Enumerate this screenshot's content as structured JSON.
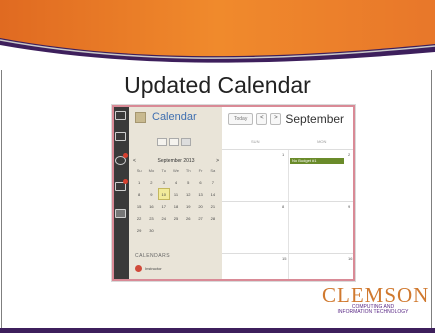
{
  "slide": {
    "title": "Updated Calendar"
  },
  "calendar": {
    "header": "Calendar",
    "today_button": "Today",
    "prev": "<",
    "next": ">",
    "month_label": "September",
    "mini": {
      "month_year": "September 2013",
      "prev": "<",
      "next": ">",
      "weekdays": [
        "Su",
        "Mo",
        "Tu",
        "We",
        "Th",
        "Fr",
        "Sa"
      ],
      "weeks": [
        [
          "1",
          "2",
          "3",
          "4",
          "5",
          "6",
          "7"
        ],
        [
          "8",
          "9",
          "10",
          "11",
          "12",
          "13",
          "14"
        ],
        [
          "15",
          "16",
          "17",
          "18",
          "19",
          "20",
          "21"
        ],
        [
          "22",
          "23",
          "24",
          "25",
          "26",
          "27",
          "28"
        ],
        [
          "29",
          "30",
          "",
          "",
          "",
          "",
          ""
        ]
      ]
    },
    "section_label": "CALENDARS",
    "calendar_entry": "Instructor",
    "day_headers": [
      "SUN",
      "MON"
    ],
    "day_numbers": [
      "1",
      "2",
      "8",
      "9",
      "15",
      "16"
    ],
    "event_label": "No Budget #1"
  },
  "logo": {
    "name": "CLEMSON",
    "line1": "COMPUTING AND",
    "line2": "INFORMATION TECHNOLOGY"
  },
  "colors": {
    "banner_purple": "#3d1f5c",
    "banner_orange": "#e8822c",
    "accent_blue": "#3f6fb0",
    "logo_orange": "#d0792f"
  }
}
